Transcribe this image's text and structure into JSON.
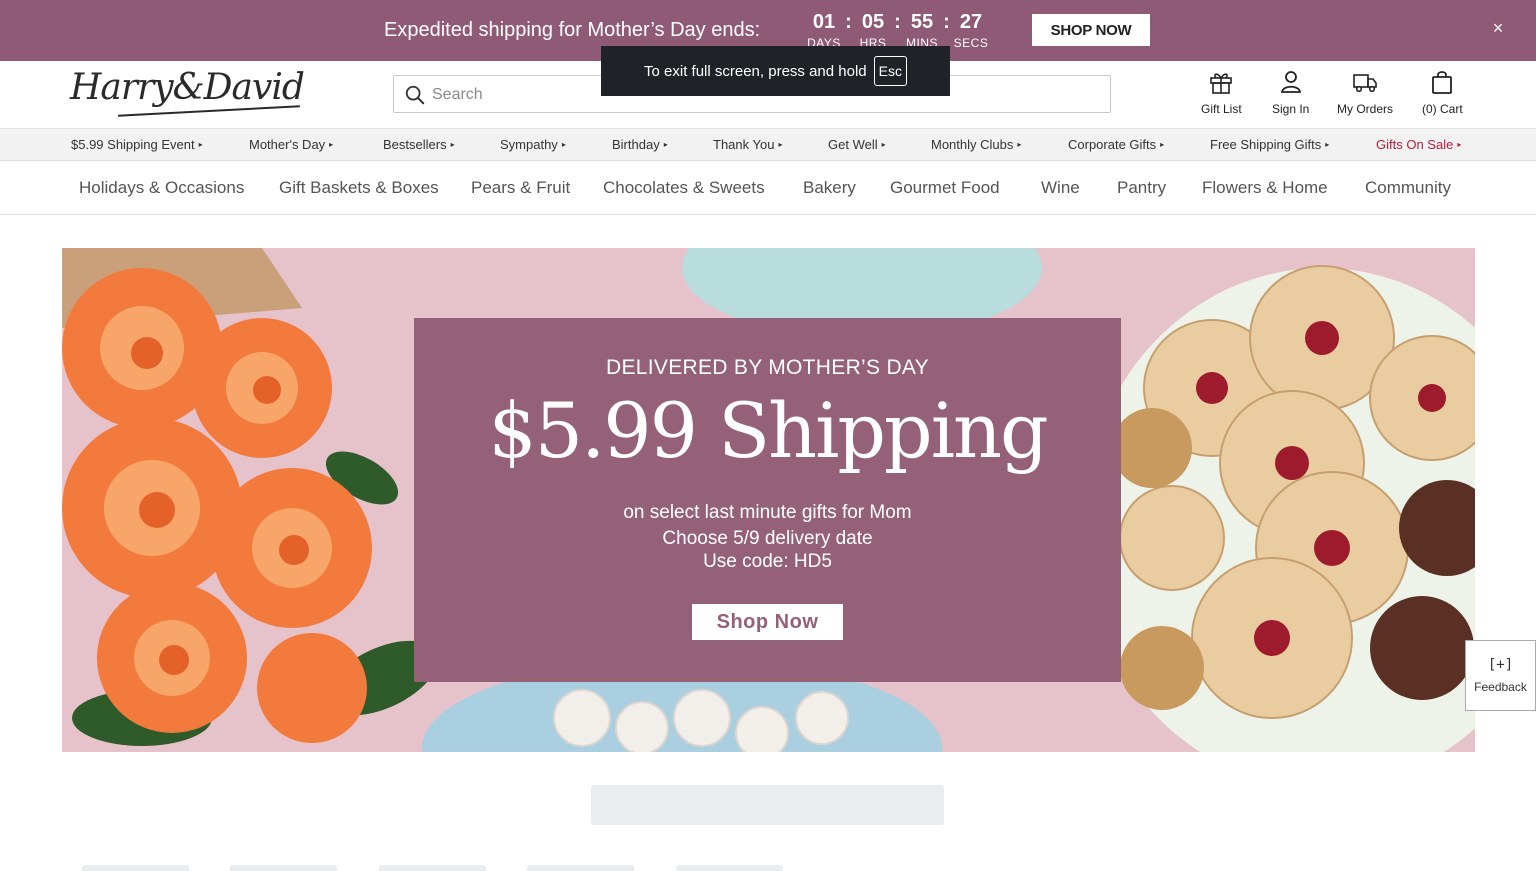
{
  "promo": {
    "message": "Expedited shipping for Mother’s Day ends:",
    "countdown": [
      {
        "value": "01",
        "label": "DAYS"
      },
      {
        "value": "05",
        "label": "HRS"
      },
      {
        "value": "55",
        "label": "MINS"
      },
      {
        "value": "27",
        "label": "SECS"
      }
    ],
    "separator": ":",
    "cta": "SHOP NOW",
    "close": "×"
  },
  "toast": {
    "text": "To exit full screen, press and hold",
    "key": "Esc"
  },
  "header": {
    "logo": "Harry&David",
    "search_placeholder": "Search",
    "actions": [
      {
        "label": "Gift List",
        "icon": "gift-icon"
      },
      {
        "label": "Sign In",
        "icon": "user-icon"
      },
      {
        "label": "My Orders",
        "icon": "truck-icon"
      },
      {
        "label": "(0) Cart",
        "icon": "bag-icon"
      }
    ]
  },
  "subnav": [
    "$5.99 Shipping Event",
    "Mother's Day",
    "Bestsellers",
    "Sympathy",
    "Birthday",
    "Thank You",
    "Get Well",
    "Monthly Clubs",
    "Corporate Gifts",
    "Free Shipping Gifts",
    "Gifts On Sale"
  ],
  "subnav_caret": "▸",
  "categories": [
    "Holidays & Occasions",
    "Gift Baskets & Boxes",
    "Pears & Fruit",
    "Chocolates & Sweets",
    "Bakery",
    "Gourmet Food",
    "Wine",
    "Pantry",
    "Flowers & Home",
    "Community"
  ],
  "hero": {
    "kicker": "DELIVERED BY MOTHER’S DAY",
    "headline": "$5.99 Shipping",
    "line1": "on select last minute gifts for Mom",
    "line2": "Choose 5/9 delivery date",
    "line3": "Use code: HD5",
    "cta": "Shop Now"
  },
  "feedback": {
    "icon": "[+]",
    "label": "Feedback"
  },
  "colors": {
    "brand": "#8e5a75",
    "panel": "#946178",
    "sale": "#b5203f"
  }
}
